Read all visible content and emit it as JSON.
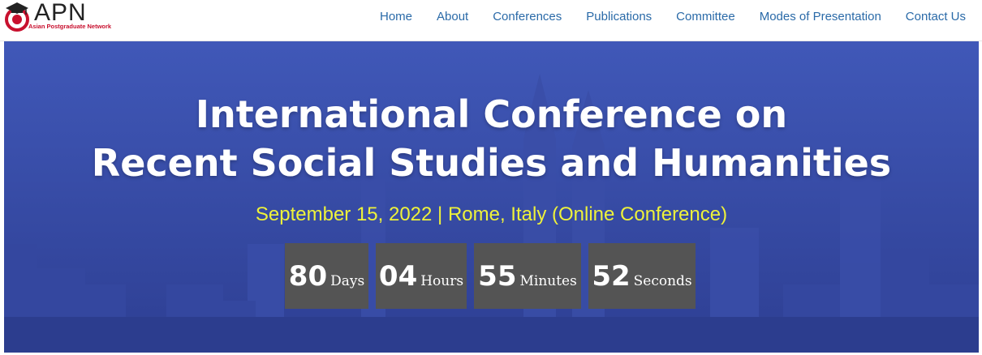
{
  "header": {
    "logo_text": "APN",
    "logo_subtitle": "Asian Postgraduate Network",
    "logo_icon": "graduation-cap-globe-icon",
    "nav": [
      {
        "label": "Home"
      },
      {
        "label": "About"
      },
      {
        "label": "Conferences"
      },
      {
        "label": "Publications"
      },
      {
        "label": "Committee"
      },
      {
        "label": "Modes of Presentation"
      },
      {
        "label": "Contact Us"
      }
    ]
  },
  "hero": {
    "title_line1": "International Conference on",
    "title_line2": "Recent Social Studies and Humanities",
    "date_location": "September 15, 2022 | Rome, Italy (Online Conference)",
    "countdown": [
      {
        "value": "80",
        "unit": "Days"
      },
      {
        "value": "04",
        "unit": "Hours"
      },
      {
        "value": "55",
        "unit": "Minutes"
      },
      {
        "value": "52",
        "unit": "Seconds"
      }
    ]
  },
  "colors": {
    "nav_link": "#2a6aa8",
    "hero_bg": "#3f56b6",
    "date_text": "#eef23a",
    "countdown_bg": "#545454",
    "logo_red": "#c8102e"
  }
}
